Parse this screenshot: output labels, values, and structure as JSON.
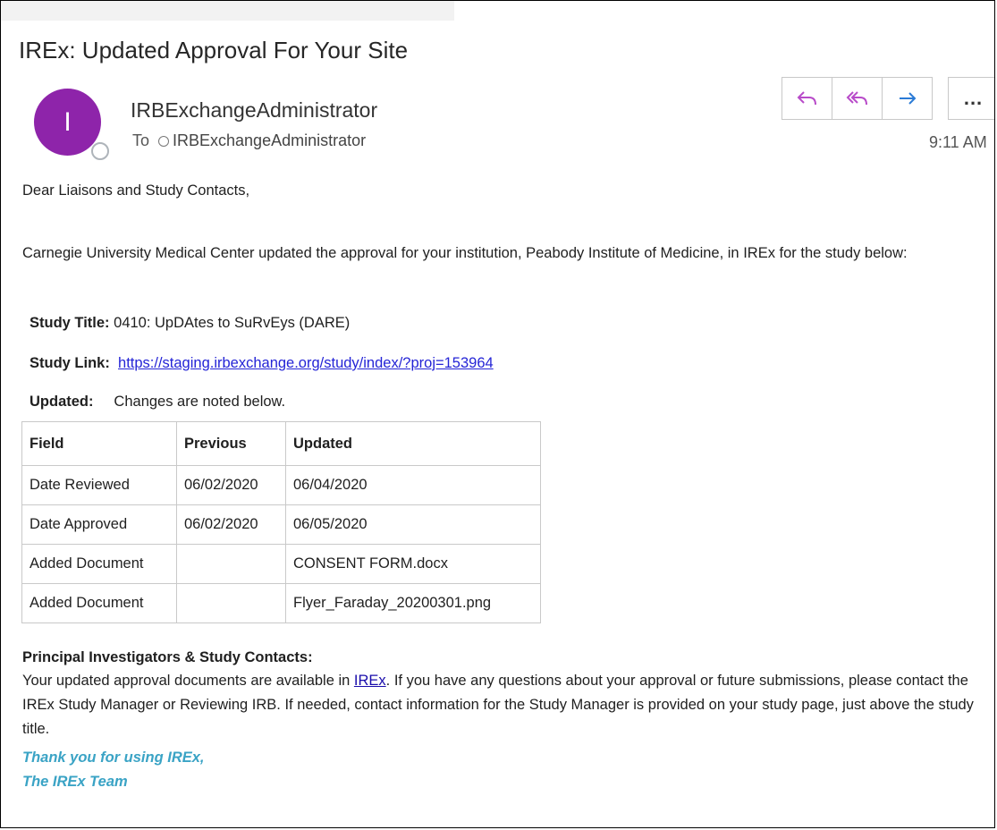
{
  "email": {
    "subject": "IREx: Updated Approval For Your Site",
    "sender": {
      "initial": "I",
      "name": "IRBExchangeAdministrator",
      "avatar_color": "#8e24aa"
    },
    "to_label": "To",
    "to_name": "IRBExchangeAdministrator",
    "time": "9:11 AM",
    "actions": {
      "reply_icon": "reply-icon",
      "reply_all_icon": "reply-all-icon",
      "forward_icon": "forward-icon",
      "more_label": "..."
    }
  },
  "body": {
    "greeting": "Dear Liaisons and Study Contacts,",
    "intro": "Carnegie University Medical Center updated the approval for your institution, Peabody Institute of Medicine, in IREx for the study below:",
    "study_title_label": "Study Title:",
    "study_title_value": "0410: UpDAtes to SuRvEys (DARE)",
    "study_link_label": "Study Link:",
    "study_link_value": "https://staging.irbexchange.org/study/index/?proj=153964",
    "updated_label": "Updated:",
    "updated_value": "Changes are noted below.",
    "table": {
      "headers": [
        "Field",
        "Previous",
        "Updated"
      ],
      "rows": [
        [
          "Date Reviewed",
          "06/02/2020",
          "06/04/2020"
        ],
        [
          "Date Approved",
          "06/02/2020",
          "06/05/2020"
        ],
        [
          "Added Document",
          "",
          "CONSENT FORM.docx"
        ],
        [
          "Added Document",
          "",
          "Flyer_Faraday_20200301.png"
        ]
      ]
    },
    "pi_heading": "Principal Investigators & Study Contacts:",
    "pi_text_before_link": "Your updated approval documents are available in ",
    "pi_link": "IREx",
    "pi_text_after_link": ". If you have any questions about your approval or future submissions, please contact the IREx Study Manager or Reviewing IRB. If needed, contact information for the Study Manager is provided on your study page, just above the study title.",
    "signoff_line1": "Thank you for using IREx,",
    "signoff_line2": "The IREx Team"
  }
}
